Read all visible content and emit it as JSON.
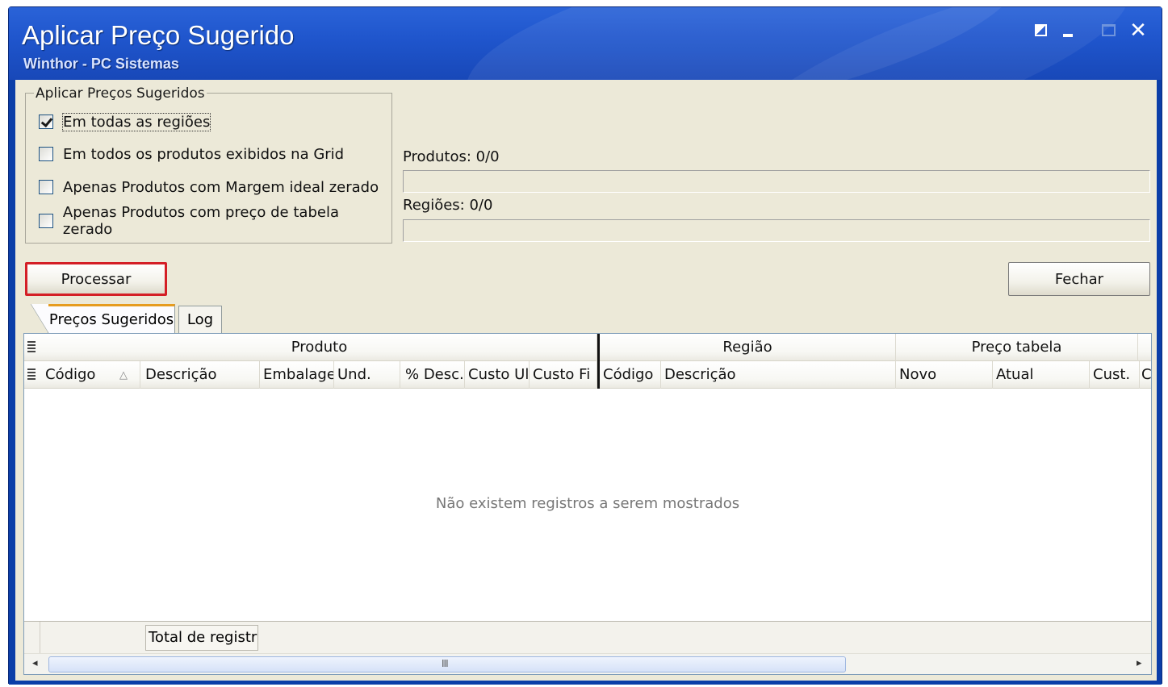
{
  "window": {
    "title": "Aplicar Preço Sugerido",
    "subtitle": "Winthor - PC Sistemas"
  },
  "options": {
    "group_label": "Aplicar Preços Sugeridos",
    "items": [
      {
        "label": "Em todas as regiões",
        "checked": true
      },
      {
        "label": "Em todos os produtos exibidos na Grid",
        "checked": false
      },
      {
        "label": "Apenas Produtos com Margem ideal zerado",
        "checked": false
      },
      {
        "label": "Apenas Produtos com preço de tabela zerado",
        "checked": false
      }
    ]
  },
  "progress": {
    "produtos_label": "Produtos: 0/0",
    "regioes_label": "Regiões: 0/0",
    "produtos_value": 0,
    "regioes_value": 0
  },
  "buttons": {
    "process": "Processar",
    "close": "Fechar"
  },
  "tabs": [
    {
      "label": "Preços Sugeridos",
      "active": true
    },
    {
      "label": "Log",
      "active": false
    }
  ],
  "grid": {
    "bands": [
      "Produto",
      "Região",
      "Preço tabela"
    ],
    "columns": [
      "Código",
      "Descrição",
      "Embalagem",
      "Und.",
      "% Desc.",
      "Custo Ul",
      "Custo Fi",
      "Código",
      "Descrição",
      "Novo",
      "Atual",
      "Cust.",
      "C"
    ],
    "empty_message": "Não existem registros a serem mostrados",
    "footer_total": "Total de registr"
  },
  "colors": {
    "title_bar": "#2458d0",
    "highlight": "#d41f26"
  }
}
